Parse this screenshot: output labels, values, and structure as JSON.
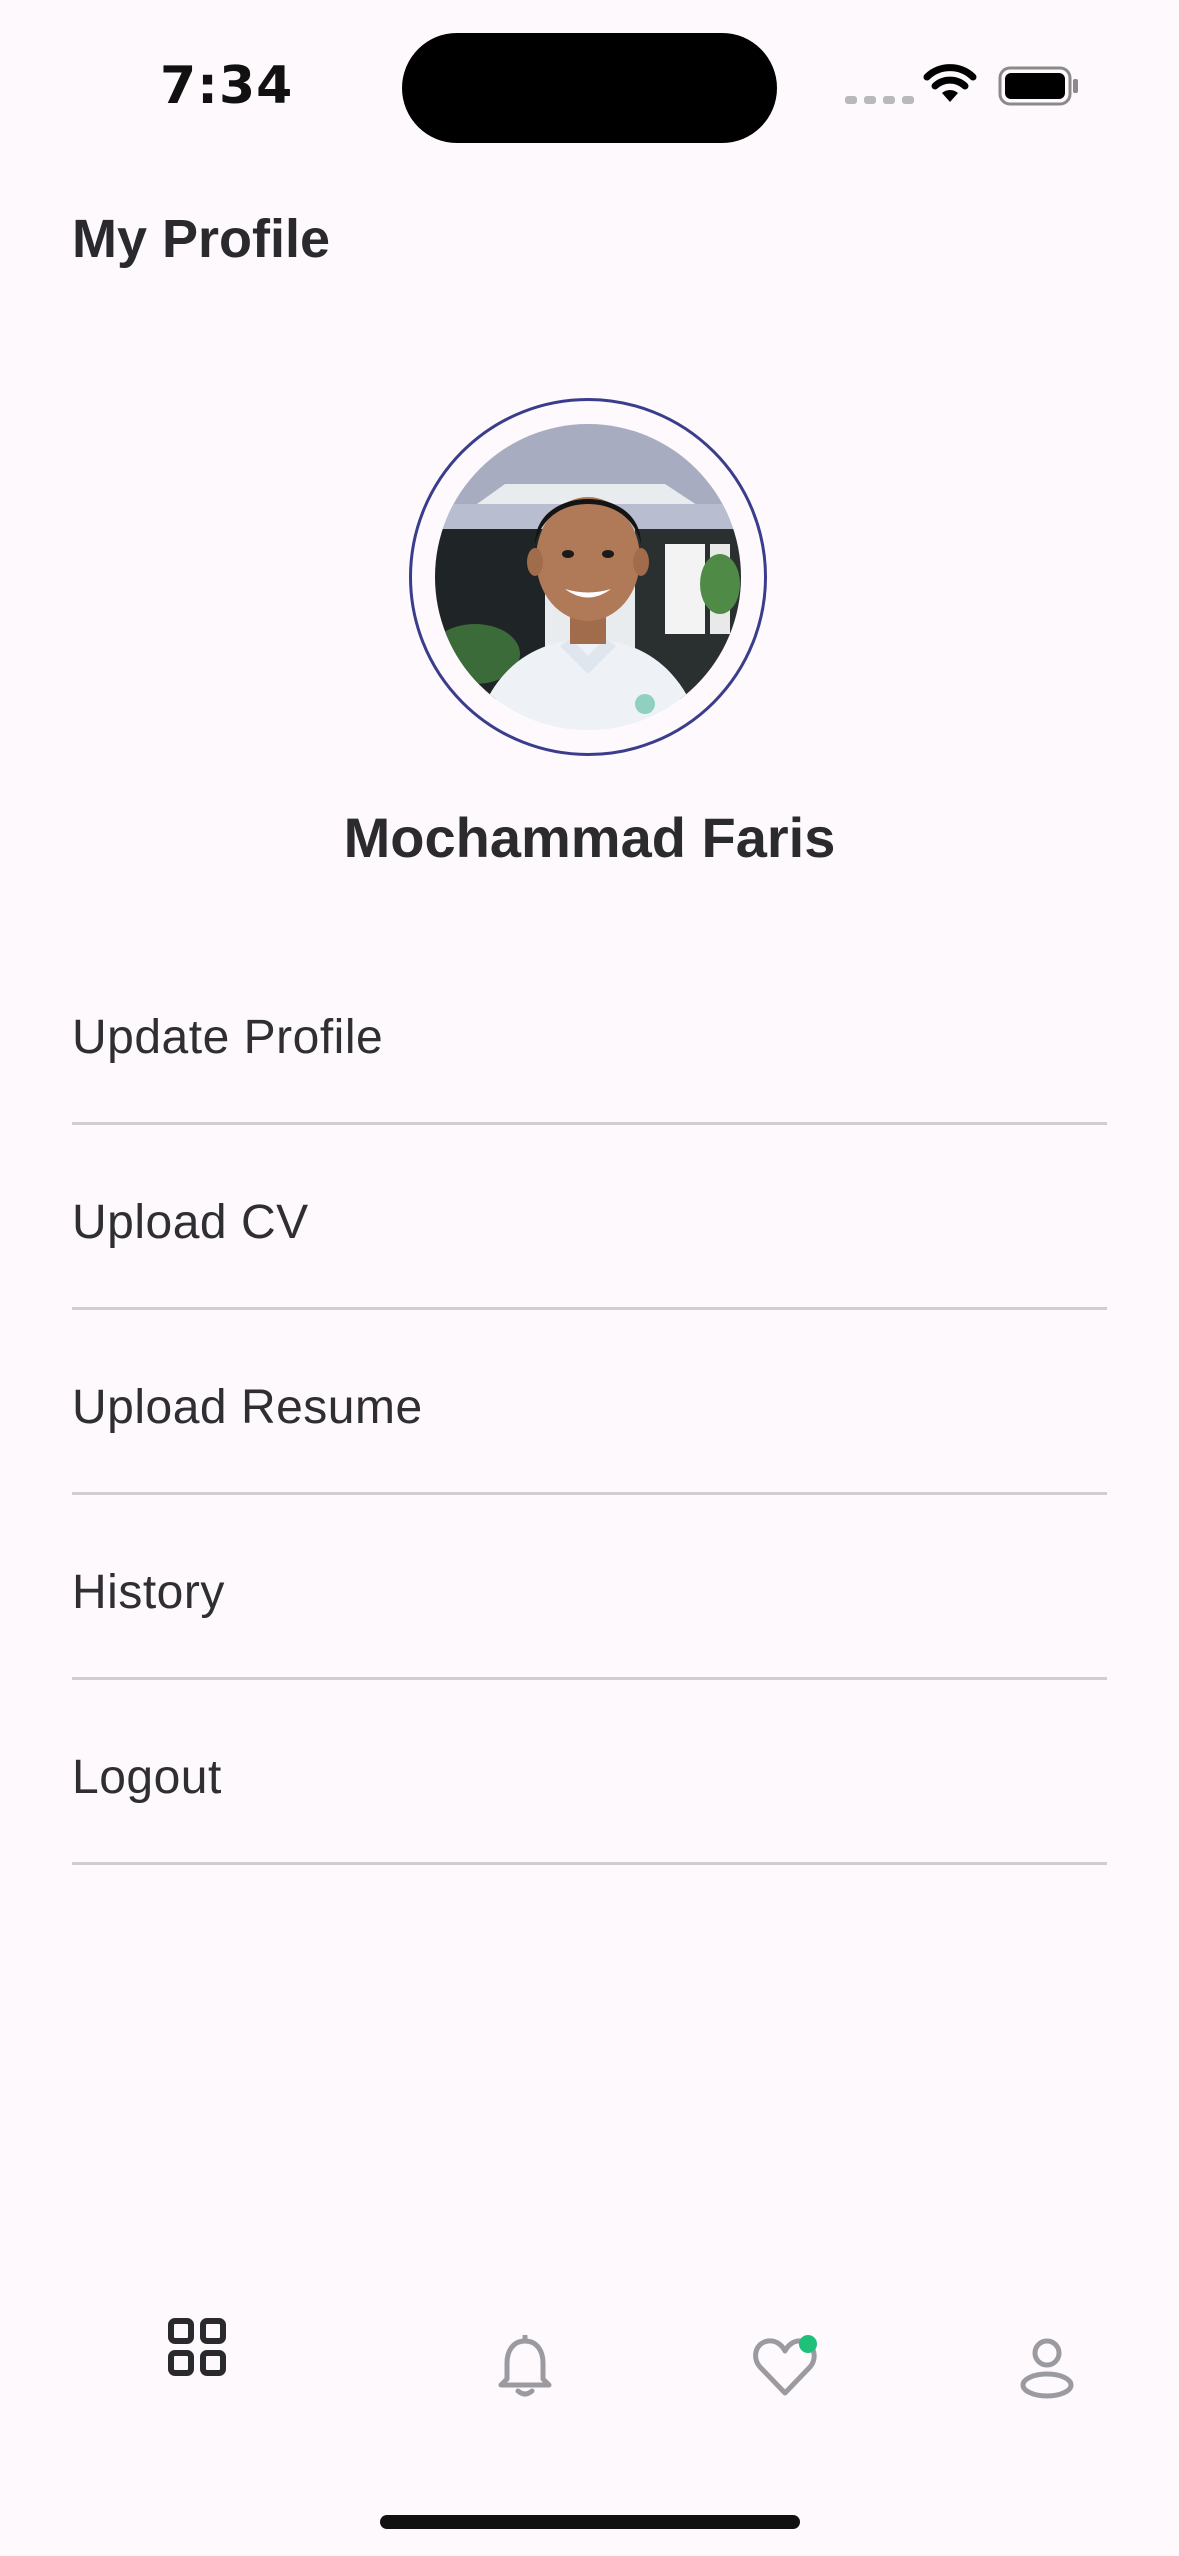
{
  "status_bar": {
    "time": "7:34",
    "icons": [
      "signal-icon",
      "wifi-icon",
      "battery-icon"
    ]
  },
  "header": {
    "title": "My Profile"
  },
  "profile": {
    "avatar": "profile-photo",
    "name": "Mochammad Faris"
  },
  "menu": {
    "items": [
      {
        "label": "Update Profile"
      },
      {
        "label": "Upload CV"
      },
      {
        "label": "Upload Resume"
      },
      {
        "label": "History"
      },
      {
        "label": "Logout"
      }
    ]
  },
  "tab_bar": {
    "items": [
      {
        "icon": "grid-icon",
        "active": true
      },
      {
        "icon": "bell-icon",
        "active": false
      },
      {
        "icon": "heart-icon",
        "active": false,
        "badge": true
      },
      {
        "icon": "user-icon",
        "active": false
      }
    ]
  },
  "colors": {
    "background": "#fdf9fc",
    "avatar_ring": "#3a3d8c",
    "badge": "#1fc07a",
    "text": "#2b2b2e",
    "divider": "#cfcfd2",
    "inactive_icon": "#9a9aa0"
  }
}
